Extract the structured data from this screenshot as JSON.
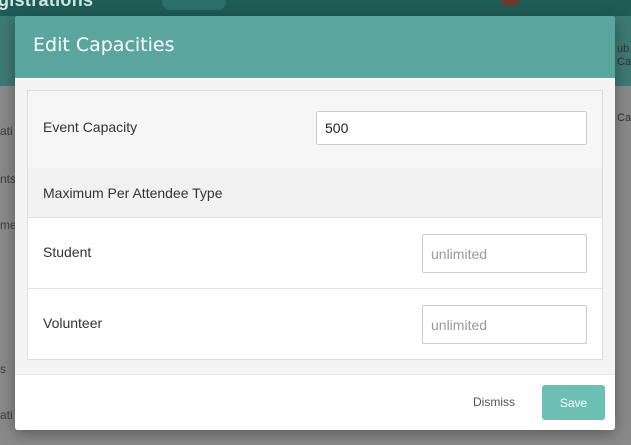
{
  "background": {
    "app_title": "gistrations",
    "sidebar_fragments": [
      "ati",
      "nts",
      "me",
      "s",
      "ati"
    ],
    "right_fragments": [
      "Ca",
      "ub",
      "Ca"
    ]
  },
  "modal": {
    "title": "Edit Capacities",
    "event_capacity": {
      "label": "Event Capacity",
      "value": "500"
    },
    "section_label": "Maximum Per Attendee Type",
    "attendee_types": [
      {
        "label": "Student",
        "placeholder": "unlimited",
        "value": ""
      },
      {
        "label": "Volunteer",
        "placeholder": "unlimited",
        "value": ""
      }
    ],
    "footer": {
      "dismiss_label": "Dismiss",
      "save_label": "Save"
    }
  },
  "colors": {
    "header": "#5aa69e",
    "save_button": "#6bc0b3",
    "overlay": "#7a7a7a"
  }
}
